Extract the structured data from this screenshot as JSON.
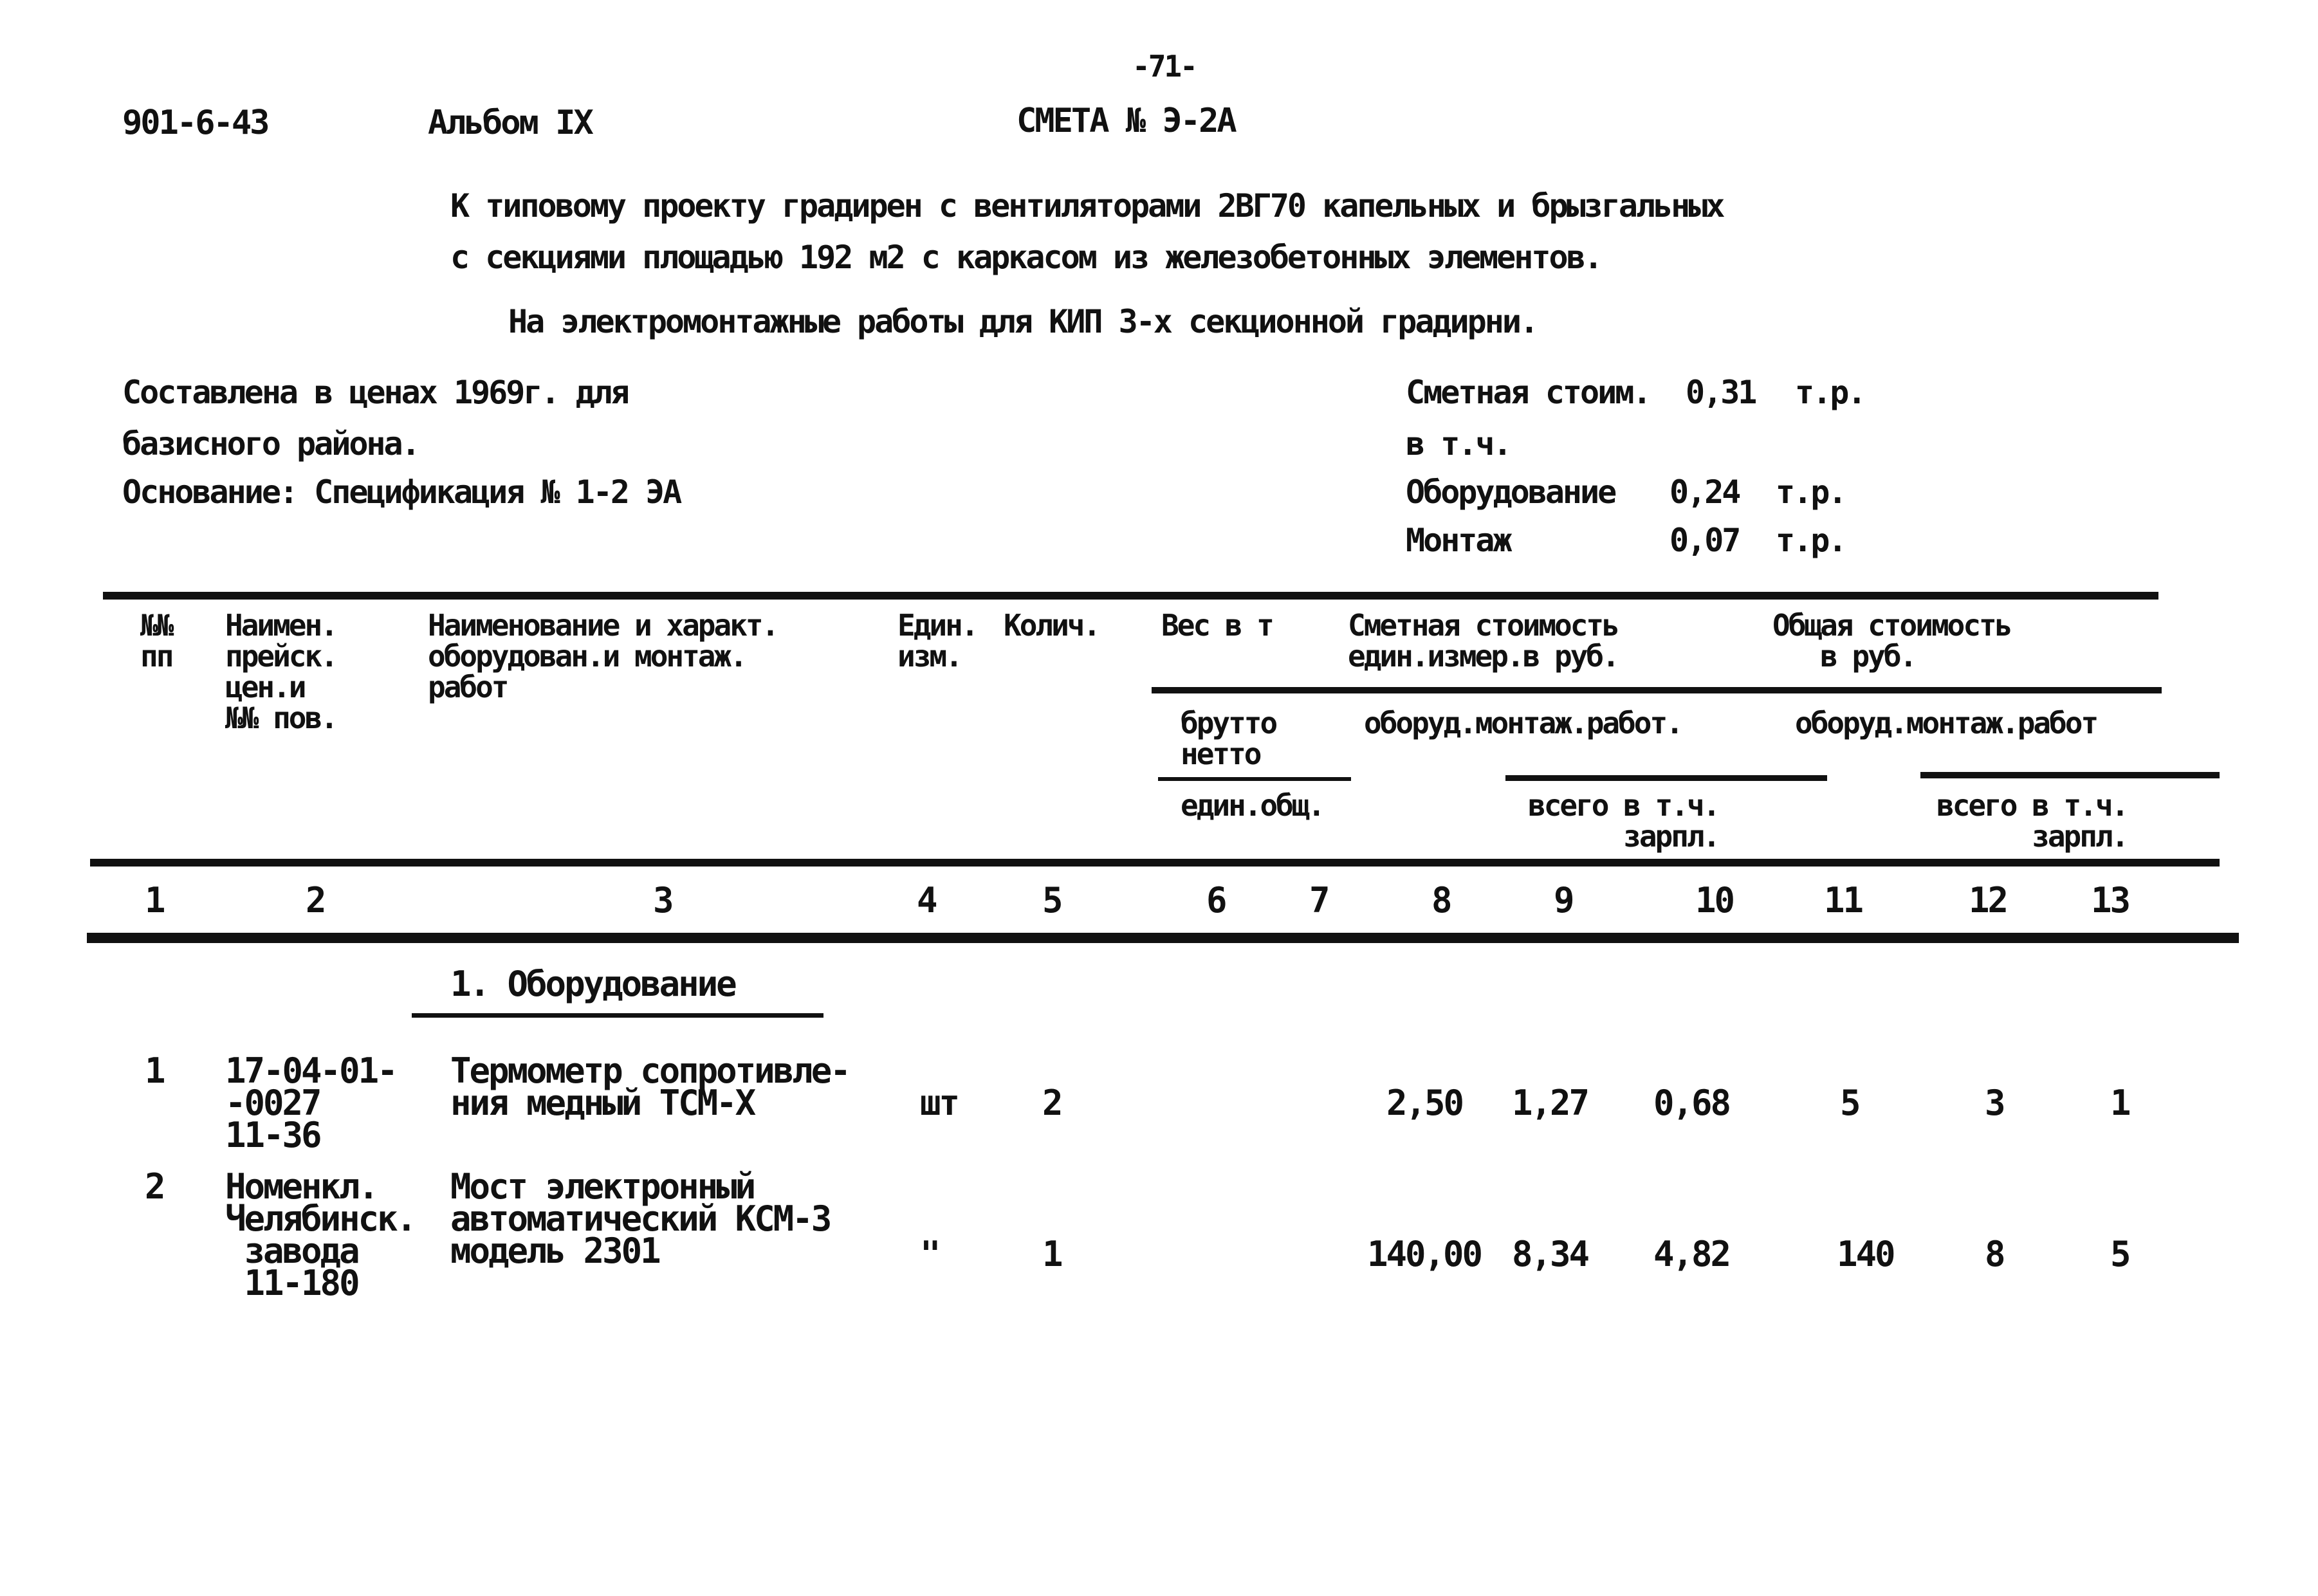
{
  "header": {
    "page_number": "-71-",
    "doc_code": "901-6-43",
    "album": "Альбом IX",
    "title": "СМЕТА № Э-2А"
  },
  "subtitle": {
    "line1": "К типовому проекту градирен с вентиляторами 2ВГ70 капельных и брызгальных",
    "line2": "с секциями площадью 192 м2 с каркасом из железобетонных элементов.",
    "line3": "На электромонтажные работы для КИП 3-х секционной градирни."
  },
  "info_left": {
    "line1": "Составлена в ценах 1969г. для",
    "line2": "базисного района.",
    "line3": "Основание: Спецификация № 1-2 ЭА"
  },
  "info_right": {
    "total_label": "Сметная стоим.",
    "total_value": "0,31",
    "total_unit": "т.р.",
    "incl_label": "в т.ч.",
    "equipment_label": "Оборудование",
    "equipment_value": "0,24",
    "equipment_unit": "т.р.",
    "install_label": "Монтаж",
    "install_value": "0,07",
    "install_unit": "т.р."
  },
  "table": {
    "headers": {
      "c1": "№№\nпп",
      "c2": "Наимен.\nпрейск.\nцен.и\n№№ пов.",
      "c3": "Наименование и характ.\nоборудован.и монтаж.\nработ",
      "c4": "Един.\nизм.",
      "c5": "Колич.",
      "weight": "Вес в т",
      "weight_sub": "брутто\nнетто",
      "weight_sub2": "един.общ.",
      "unit_cost": "Сметная стоимость\nедин.измер.в руб.",
      "unit_cost_sub": "оборуд.монтаж.работ.",
      "unit_cost_sub2": "всего в т.ч.\n      зарпл.",
      "total_cost": "Общая стоимость\n   в руб.",
      "total_cost_sub": "оборуд.монтаж.работ",
      "total_cost_sub2": "всего в т.ч.\n      зарпл."
    },
    "column_numbers": [
      "1",
      "2",
      "3",
      "4",
      "5",
      "6",
      "7",
      "8",
      "9",
      "10",
      "11",
      "12",
      "13"
    ],
    "section_title": "1. Оборудование",
    "rows": [
      {
        "num": "1",
        "code": "17-04-01-\n-0027\n11-36",
        "name": "Термометр сопротивле-\nния медный ТСМ-Х",
        "unit": "шт",
        "qty": "2",
        "w_unit": "",
        "w_total": "",
        "unit_equip": "2,50",
        "unit_install_total": "1,27",
        "unit_install_wage": "0,68",
        "total_equip": "5",
        "total_install_total": "3",
        "total_install_wage": "1"
      },
      {
        "num": "2",
        "code": "Номенкл.\nЧелябинск.\n завода\n 11-180",
        "name": "Мост электронный\nавтоматический КСМ-3\nмодель 2301",
        "unit": "\"",
        "qty": "1",
        "w_unit": "",
        "w_total": "",
        "unit_equip": "140,00",
        "unit_install_total": "8,34",
        "unit_install_wage": "4,82",
        "total_equip": "140",
        "total_install_total": "8",
        "total_install_wage": "5"
      }
    ]
  }
}
